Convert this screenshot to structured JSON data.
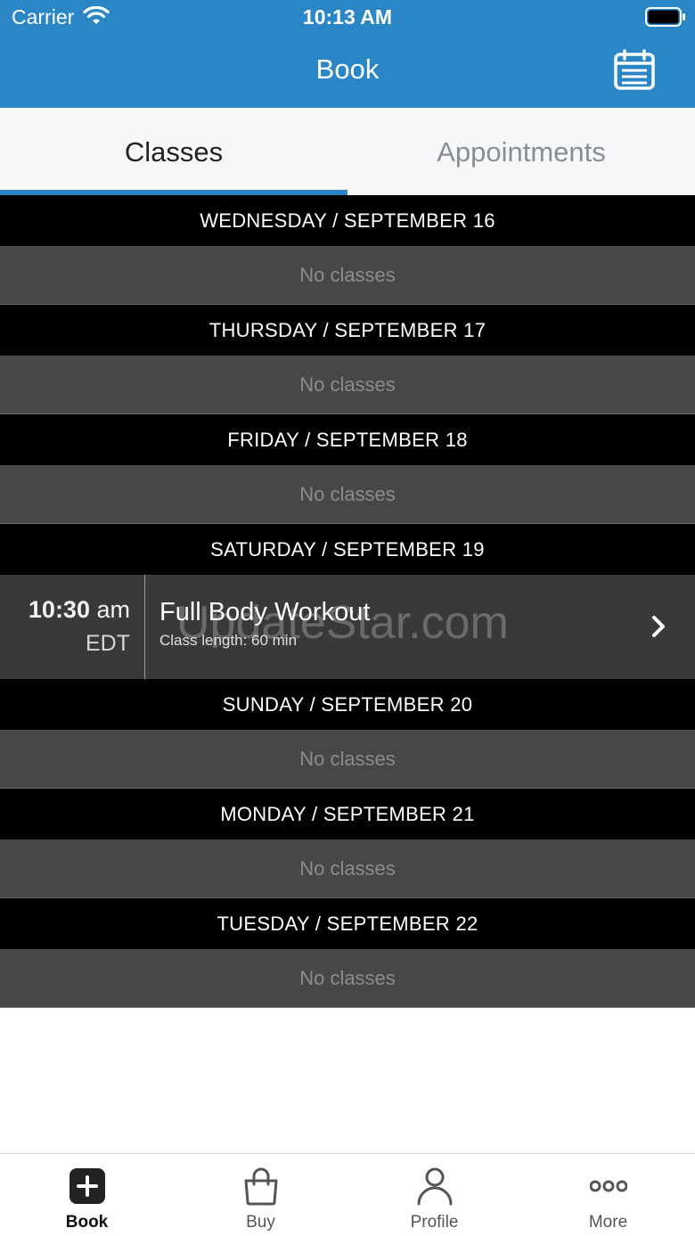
{
  "status_bar": {
    "carrier": "Carrier",
    "time": "10:13 AM"
  },
  "nav": {
    "title": "Book",
    "calendar_icon": "calendar-icon"
  },
  "tabs": [
    {
      "label": "Classes",
      "active": true
    },
    {
      "label": "Appointments",
      "active": false
    }
  ],
  "days": [
    {
      "header": "WEDNESDAY / SEPTEMBER 16",
      "empty_text": "No classes"
    },
    {
      "header": "THURSDAY / SEPTEMBER 17",
      "empty_text": "No classes"
    },
    {
      "header": "FRIDAY / SEPTEMBER 18",
      "empty_text": "No classes"
    },
    {
      "header": "SATURDAY / SEPTEMBER 19",
      "class": {
        "time": "10:30",
        "ampm": "am",
        "tz": "EDT",
        "name": "Full Body Workout",
        "length": "Class length: 60 min"
      }
    },
    {
      "header": "SUNDAY / SEPTEMBER 20",
      "empty_text": "No classes"
    },
    {
      "header": "MONDAY / SEPTEMBER 21",
      "empty_text": "No classes"
    },
    {
      "header": "TUESDAY / SEPTEMBER 22",
      "empty_text": "No classes"
    }
  ],
  "watermark": "UpdateStar.com",
  "tab_bar": [
    {
      "label": "Book",
      "icon": "plus-square-icon",
      "active": true
    },
    {
      "label": "Buy",
      "icon": "shopping-bag-icon",
      "active": false
    },
    {
      "label": "Profile",
      "icon": "person-icon",
      "active": false
    },
    {
      "label": "More",
      "icon": "more-dots-icon",
      "active": false
    }
  ],
  "colors": {
    "accent": "#2b86c5",
    "day_header_bg": "#000000",
    "empty_row_bg": "#474747",
    "class_row_bg": "#393939"
  }
}
